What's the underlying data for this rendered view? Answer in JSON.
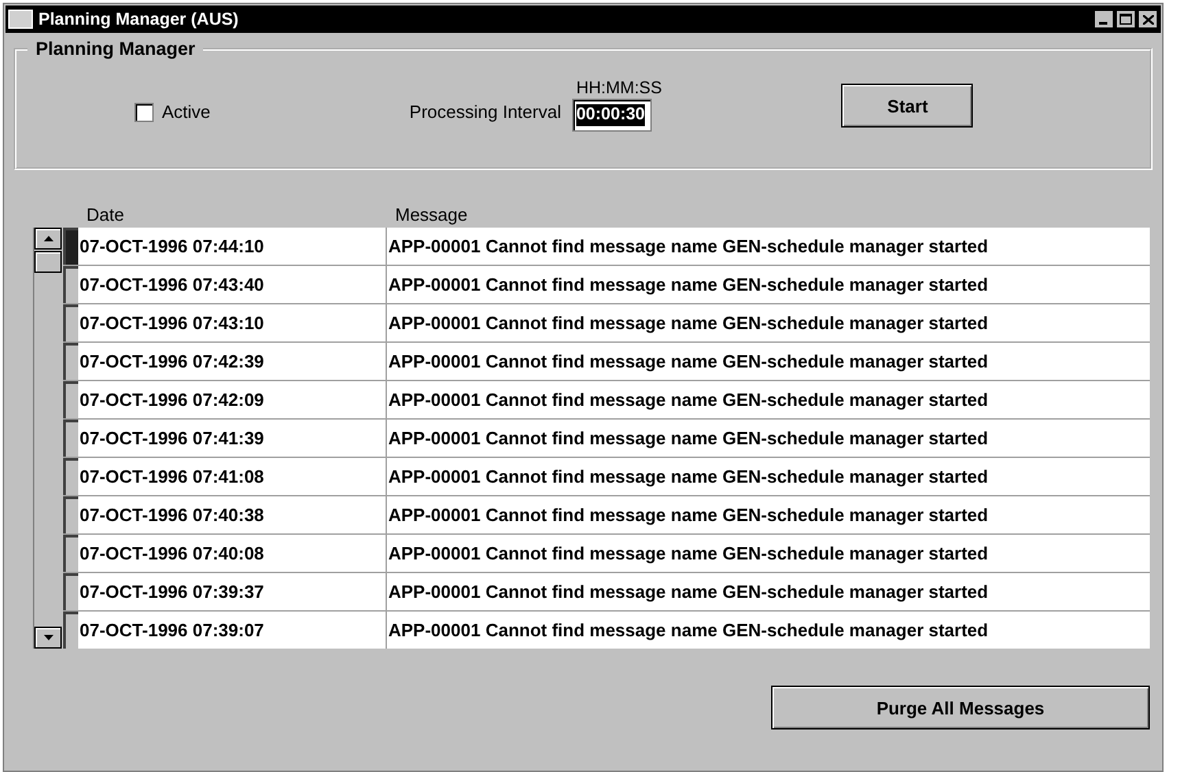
{
  "window": {
    "title": "Planning Manager (AUS)"
  },
  "planning_manager": {
    "title": "Planning Manager",
    "active": {
      "label": "Active",
      "checked": false
    },
    "interval": {
      "label": "Processing Interval",
      "format": "HH:MM:SS",
      "value": "00:00:30"
    },
    "start_button": "Start"
  },
  "table": {
    "columns": [
      "Date",
      "Message"
    ],
    "rows": [
      {
        "date": "07-OCT-1996 07:44:10",
        "message": "APP-00001 Cannot find message name GEN-schedule manager started",
        "selected": true
      },
      {
        "date": "07-OCT-1996 07:43:40",
        "message": "APP-00001 Cannot find message name GEN-schedule manager started",
        "selected": false
      },
      {
        "date": "07-OCT-1996 07:43:10",
        "message": "APP-00001 Cannot find message name GEN-schedule manager started",
        "selected": false
      },
      {
        "date": "07-OCT-1996 07:42:39",
        "message": "APP-00001 Cannot find message name GEN-schedule manager started",
        "selected": false
      },
      {
        "date": "07-OCT-1996 07:42:09",
        "message": "APP-00001 Cannot find message name GEN-schedule manager started",
        "selected": false
      },
      {
        "date": "07-OCT-1996 07:41:39",
        "message": "APP-00001 Cannot find message name GEN-schedule manager started",
        "selected": false
      },
      {
        "date": "07-OCT-1996 07:41:08",
        "message": "APP-00001 Cannot find message name GEN-schedule manager started",
        "selected": false
      },
      {
        "date": "07-OCT-1996 07:40:38",
        "message": "APP-00001 Cannot find message name GEN-schedule manager started",
        "selected": false
      },
      {
        "date": "07-OCT-1996 07:40:08",
        "message": "APP-00001 Cannot find message name GEN-schedule manager started",
        "selected": false
      },
      {
        "date": "07-OCT-1996 07:39:37",
        "message": "APP-00001 Cannot find message name GEN-schedule manager started",
        "selected": false
      },
      {
        "date": "07-OCT-1996 07:39:07",
        "message": "APP-00001 Cannot find message name GEN-schedule manager started",
        "selected": false
      }
    ]
  },
  "purge_button": "Purge All Messages"
}
